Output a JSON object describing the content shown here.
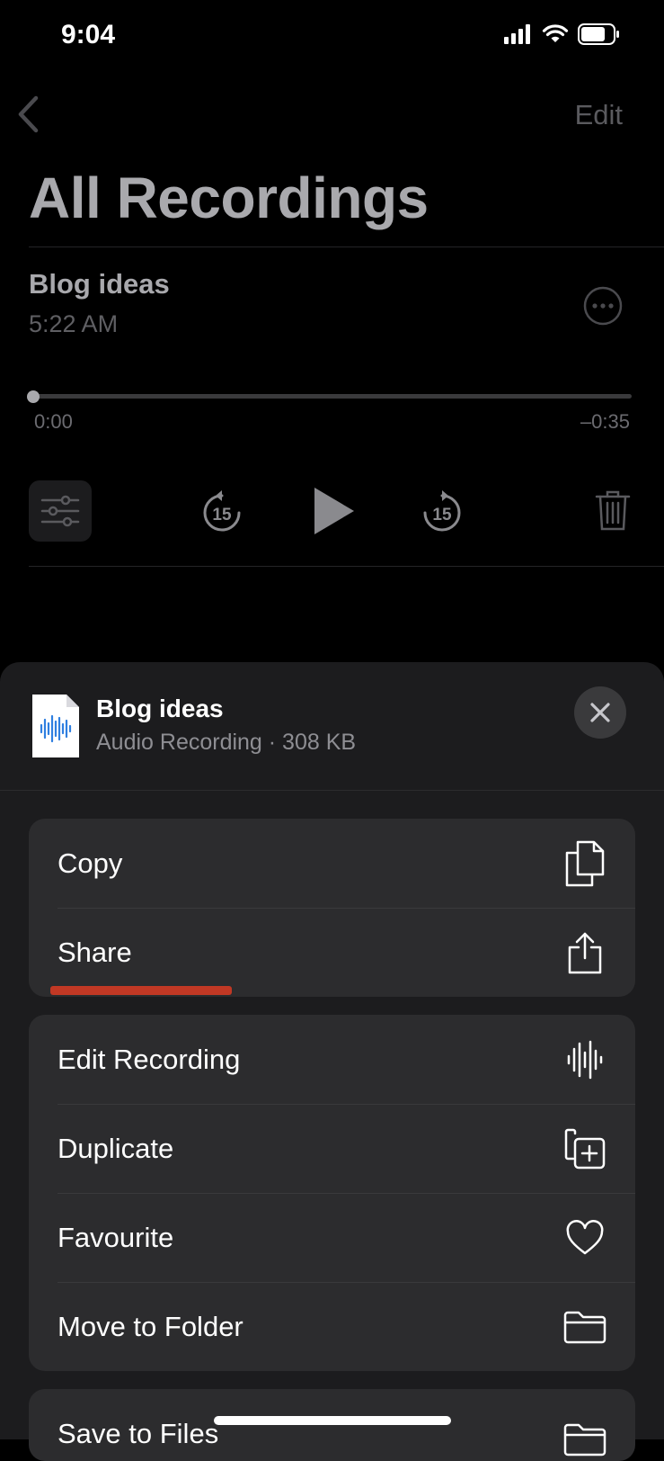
{
  "status": {
    "time": "9:04"
  },
  "header": {
    "edit_label": "Edit",
    "title": "All Recordings"
  },
  "recording": {
    "title": "Blog ideas",
    "time": "5:22 AM",
    "elapsed": "0:00",
    "remaining": "–0:35",
    "progress": 0,
    "skip_back_label": "15",
    "skip_forward_label": "15"
  },
  "sheet": {
    "file_title": "Blog ideas",
    "file_subtitle": "Audio Recording · 308 KB",
    "group1": [
      {
        "label": "Copy",
        "icon": "copy-icon"
      },
      {
        "label": "Share",
        "icon": "share-icon"
      }
    ],
    "group2": [
      {
        "label": "Edit Recording",
        "icon": "waveform-icon"
      },
      {
        "label": "Duplicate",
        "icon": "duplicate-icon"
      },
      {
        "label": "Favourite",
        "icon": "heart-icon"
      },
      {
        "label": "Move to Folder",
        "icon": "folder-icon"
      }
    ],
    "group3": [
      {
        "label": "Save to Files",
        "icon": "folder-icon"
      }
    ]
  },
  "colors": {
    "highlight": "#d23a24",
    "sheet_bg": "#1c1c1e",
    "row_bg": "#2c2c2e"
  }
}
